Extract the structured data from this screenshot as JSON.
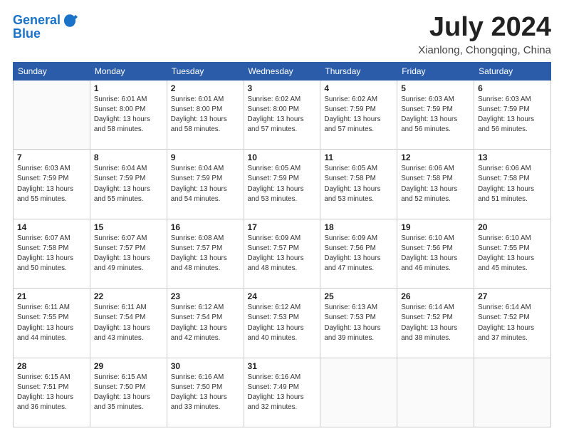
{
  "header": {
    "logo_line1": "General",
    "logo_line2": "Blue",
    "title": "July 2024",
    "subtitle": "Xianlong, Chongqing, China"
  },
  "weekdays": [
    "Sunday",
    "Monday",
    "Tuesday",
    "Wednesday",
    "Thursday",
    "Friday",
    "Saturday"
  ],
  "weeks": [
    [
      {
        "day": "",
        "sunrise": "",
        "sunset": "",
        "daylight": ""
      },
      {
        "day": "1",
        "sunrise": "Sunrise: 6:01 AM",
        "sunset": "Sunset: 8:00 PM",
        "daylight": "Daylight: 13 hours and 58 minutes."
      },
      {
        "day": "2",
        "sunrise": "Sunrise: 6:01 AM",
        "sunset": "Sunset: 8:00 PM",
        "daylight": "Daylight: 13 hours and 58 minutes."
      },
      {
        "day": "3",
        "sunrise": "Sunrise: 6:02 AM",
        "sunset": "Sunset: 8:00 PM",
        "daylight": "Daylight: 13 hours and 57 minutes."
      },
      {
        "day": "4",
        "sunrise": "Sunrise: 6:02 AM",
        "sunset": "Sunset: 7:59 PM",
        "daylight": "Daylight: 13 hours and 57 minutes."
      },
      {
        "day": "5",
        "sunrise": "Sunrise: 6:03 AM",
        "sunset": "Sunset: 7:59 PM",
        "daylight": "Daylight: 13 hours and 56 minutes."
      },
      {
        "day": "6",
        "sunrise": "Sunrise: 6:03 AM",
        "sunset": "Sunset: 7:59 PM",
        "daylight": "Daylight: 13 hours and 56 minutes."
      }
    ],
    [
      {
        "day": "7",
        "sunrise": "Sunrise: 6:03 AM",
        "sunset": "Sunset: 7:59 PM",
        "daylight": "Daylight: 13 hours and 55 minutes."
      },
      {
        "day": "8",
        "sunrise": "Sunrise: 6:04 AM",
        "sunset": "Sunset: 7:59 PM",
        "daylight": "Daylight: 13 hours and 55 minutes."
      },
      {
        "day": "9",
        "sunrise": "Sunrise: 6:04 AM",
        "sunset": "Sunset: 7:59 PM",
        "daylight": "Daylight: 13 hours and 54 minutes."
      },
      {
        "day": "10",
        "sunrise": "Sunrise: 6:05 AM",
        "sunset": "Sunset: 7:59 PM",
        "daylight": "Daylight: 13 hours and 53 minutes."
      },
      {
        "day": "11",
        "sunrise": "Sunrise: 6:05 AM",
        "sunset": "Sunset: 7:58 PM",
        "daylight": "Daylight: 13 hours and 53 minutes."
      },
      {
        "day": "12",
        "sunrise": "Sunrise: 6:06 AM",
        "sunset": "Sunset: 7:58 PM",
        "daylight": "Daylight: 13 hours and 52 minutes."
      },
      {
        "day": "13",
        "sunrise": "Sunrise: 6:06 AM",
        "sunset": "Sunset: 7:58 PM",
        "daylight": "Daylight: 13 hours and 51 minutes."
      }
    ],
    [
      {
        "day": "14",
        "sunrise": "Sunrise: 6:07 AM",
        "sunset": "Sunset: 7:58 PM",
        "daylight": "Daylight: 13 hours and 50 minutes."
      },
      {
        "day": "15",
        "sunrise": "Sunrise: 6:07 AM",
        "sunset": "Sunset: 7:57 PM",
        "daylight": "Daylight: 13 hours and 49 minutes."
      },
      {
        "day": "16",
        "sunrise": "Sunrise: 6:08 AM",
        "sunset": "Sunset: 7:57 PM",
        "daylight": "Daylight: 13 hours and 48 minutes."
      },
      {
        "day": "17",
        "sunrise": "Sunrise: 6:09 AM",
        "sunset": "Sunset: 7:57 PM",
        "daylight": "Daylight: 13 hours and 48 minutes."
      },
      {
        "day": "18",
        "sunrise": "Sunrise: 6:09 AM",
        "sunset": "Sunset: 7:56 PM",
        "daylight": "Daylight: 13 hours and 47 minutes."
      },
      {
        "day": "19",
        "sunrise": "Sunrise: 6:10 AM",
        "sunset": "Sunset: 7:56 PM",
        "daylight": "Daylight: 13 hours and 46 minutes."
      },
      {
        "day": "20",
        "sunrise": "Sunrise: 6:10 AM",
        "sunset": "Sunset: 7:55 PM",
        "daylight": "Daylight: 13 hours and 45 minutes."
      }
    ],
    [
      {
        "day": "21",
        "sunrise": "Sunrise: 6:11 AM",
        "sunset": "Sunset: 7:55 PM",
        "daylight": "Daylight: 13 hours and 44 minutes."
      },
      {
        "day": "22",
        "sunrise": "Sunrise: 6:11 AM",
        "sunset": "Sunset: 7:54 PM",
        "daylight": "Daylight: 13 hours and 43 minutes."
      },
      {
        "day": "23",
        "sunrise": "Sunrise: 6:12 AM",
        "sunset": "Sunset: 7:54 PM",
        "daylight": "Daylight: 13 hours and 42 minutes."
      },
      {
        "day": "24",
        "sunrise": "Sunrise: 6:12 AM",
        "sunset": "Sunset: 7:53 PM",
        "daylight": "Daylight: 13 hours and 40 minutes."
      },
      {
        "day": "25",
        "sunrise": "Sunrise: 6:13 AM",
        "sunset": "Sunset: 7:53 PM",
        "daylight": "Daylight: 13 hours and 39 minutes."
      },
      {
        "day": "26",
        "sunrise": "Sunrise: 6:14 AM",
        "sunset": "Sunset: 7:52 PM",
        "daylight": "Daylight: 13 hours and 38 minutes."
      },
      {
        "day": "27",
        "sunrise": "Sunrise: 6:14 AM",
        "sunset": "Sunset: 7:52 PM",
        "daylight": "Daylight: 13 hours and 37 minutes."
      }
    ],
    [
      {
        "day": "28",
        "sunrise": "Sunrise: 6:15 AM",
        "sunset": "Sunset: 7:51 PM",
        "daylight": "Daylight: 13 hours and 36 minutes."
      },
      {
        "day": "29",
        "sunrise": "Sunrise: 6:15 AM",
        "sunset": "Sunset: 7:50 PM",
        "daylight": "Daylight: 13 hours and 35 minutes."
      },
      {
        "day": "30",
        "sunrise": "Sunrise: 6:16 AM",
        "sunset": "Sunset: 7:50 PM",
        "daylight": "Daylight: 13 hours and 33 minutes."
      },
      {
        "day": "31",
        "sunrise": "Sunrise: 6:16 AM",
        "sunset": "Sunset: 7:49 PM",
        "daylight": "Daylight: 13 hours and 32 minutes."
      },
      {
        "day": "",
        "sunrise": "",
        "sunset": "",
        "daylight": ""
      },
      {
        "day": "",
        "sunrise": "",
        "sunset": "",
        "daylight": ""
      },
      {
        "day": "",
        "sunrise": "",
        "sunset": "",
        "daylight": ""
      }
    ]
  ]
}
